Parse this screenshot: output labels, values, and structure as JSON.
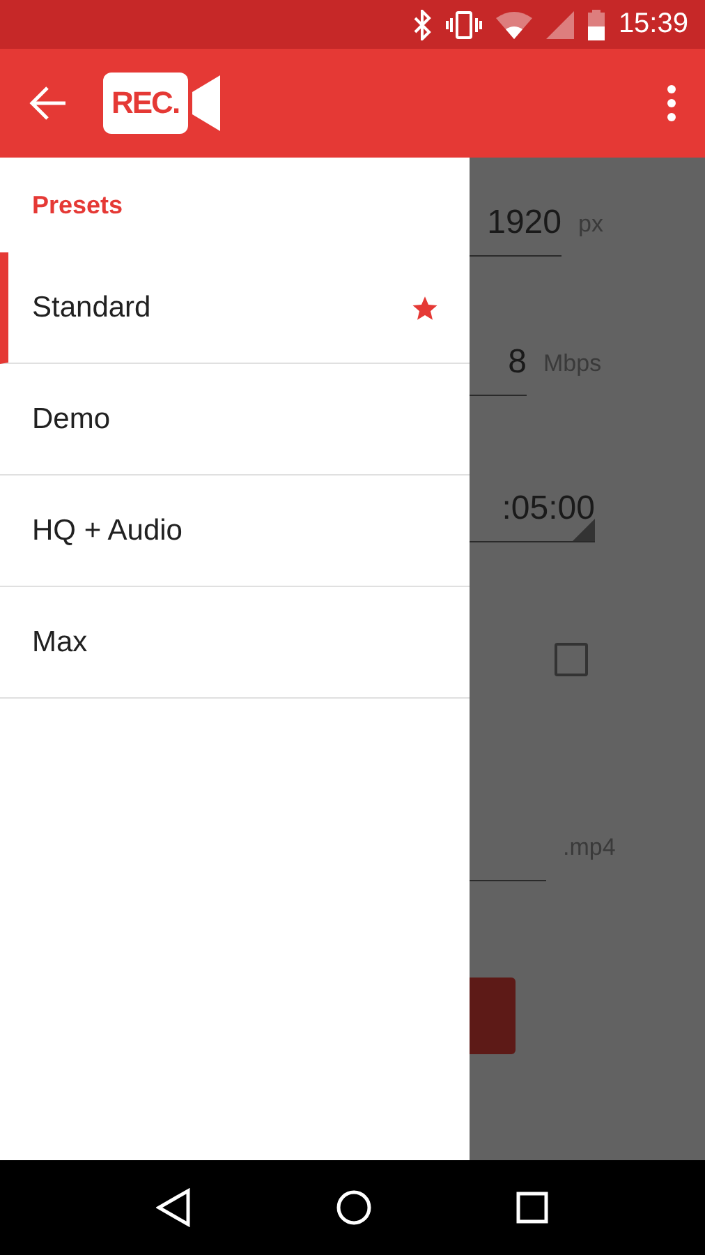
{
  "status_bar": {
    "time": "15:39"
  },
  "app_bar": {
    "logo_text": "REC."
  },
  "drawer": {
    "header": "Presets",
    "items": [
      {
        "label": "Standard",
        "selected": true,
        "starred": true
      },
      {
        "label": "Demo",
        "selected": false,
        "starred": false
      },
      {
        "label": "HQ + Audio",
        "selected": false,
        "starred": false
      },
      {
        "label": "Max",
        "selected": false,
        "starred": false
      }
    ]
  },
  "background": {
    "fields": [
      {
        "kind": "text",
        "value": "1920",
        "suffix": "px"
      },
      {
        "kind": "text",
        "value": "8",
        "suffix": "Mbps"
      },
      {
        "kind": "spinner",
        "value": ":05:00"
      },
      {
        "kind": "checkbox",
        "checked": false
      },
      {
        "kind": "text",
        "suffix": ".mp4"
      },
      {
        "kind": "button"
      }
    ]
  }
}
